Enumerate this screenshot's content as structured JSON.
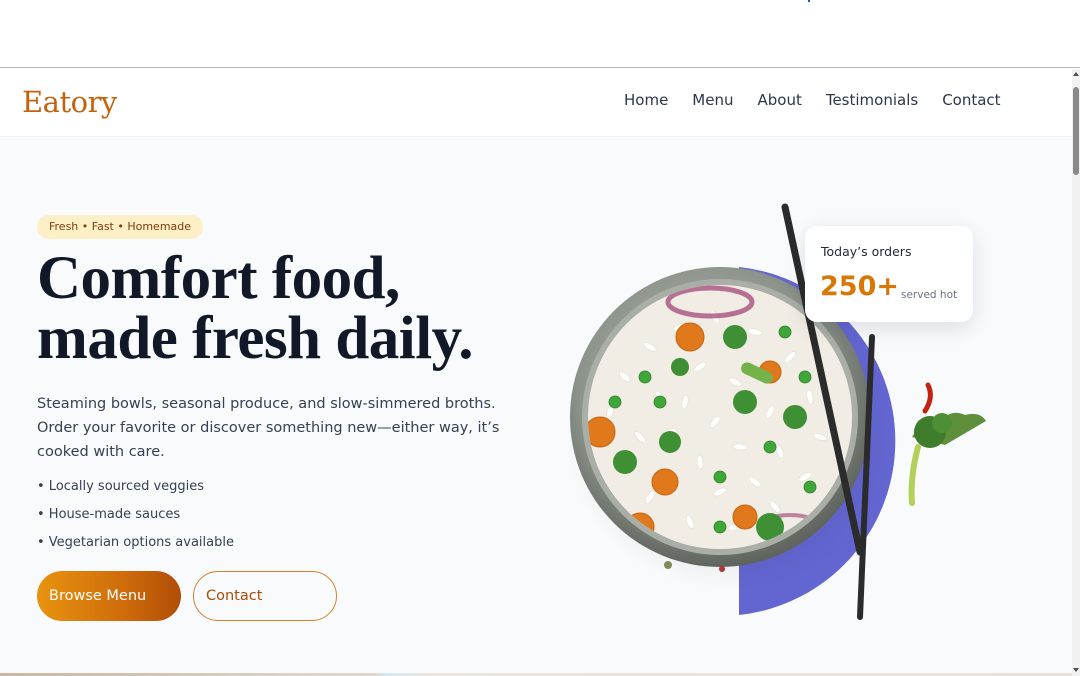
{
  "brand": {
    "logo_text": "Eatory",
    "color": "#c2620c"
  },
  "nav": {
    "items": [
      {
        "label": "Home"
      },
      {
        "label": "Menu"
      },
      {
        "label": "About"
      },
      {
        "label": "Testimonials"
      },
      {
        "label": "Contact"
      }
    ]
  },
  "hero": {
    "badge": "Fresh • Fast • Homemade",
    "headline_line1": "Comfort food,",
    "headline_line2": "made fresh daily.",
    "lead": "Steaming bowls, seasonal produce, and slow-simmered broths. Order your favorite or discover something new—either way, it’s cooked with care.",
    "features": [
      "• Locally sourced veggies",
      "• House-made sauces",
      "• Vegetarian options available"
    ],
    "primary_button": "Browse Menu",
    "secondary_button": "Contact"
  },
  "stats": {
    "title": "Today’s orders",
    "value": "250+",
    "caption": "served hot"
  },
  "colors": {
    "accent": "#d97706",
    "accent_dark": "#b04d07",
    "heading": "#111827",
    "background": "#f8fafc",
    "art_backdrop": "#6366d1"
  }
}
